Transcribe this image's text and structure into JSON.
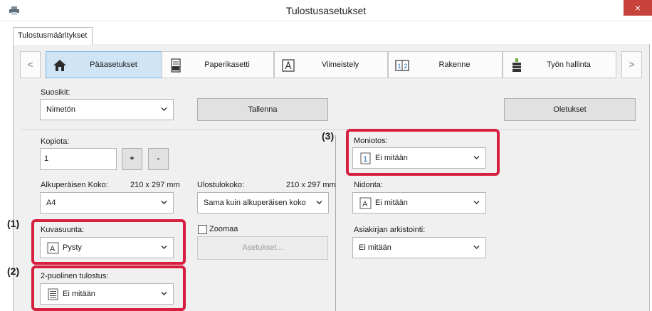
{
  "window": {
    "title": "Tulostusasetukset",
    "close_glyph": "×",
    "app_icon": "printer-icon"
  },
  "top_tab": {
    "label": "Tulostusmääritykset"
  },
  "nav": {
    "prev_glyph": "<",
    "next_glyph": ">",
    "tabs": [
      {
        "label": "Pääasetukset",
        "icon": "home-icon",
        "active": true
      },
      {
        "label": "Paperikasetti",
        "icon": "paper-tray-icon",
        "active": false
      },
      {
        "label": "Viimeistely",
        "icon": "finishing-icon",
        "active": false
      },
      {
        "label": "Rakenne",
        "icon": "layout-icon",
        "active": false
      },
      {
        "label": "Työn hallinta",
        "icon": "job-control-icon",
        "active": false
      }
    ]
  },
  "favorites": {
    "label": "Suosikit:",
    "value": "Nimetön",
    "save_label": "Tallenna",
    "defaults_label": "Oletukset"
  },
  "copies": {
    "label": "Kopiota:",
    "value": "1",
    "plus": "+",
    "minus": "-"
  },
  "original_size": {
    "label": "Alkuperäisen Koko:",
    "dims": "210 x 297 mm",
    "value": "A4"
  },
  "output_size": {
    "label": "Ulostulokoko:",
    "dims": "210 x 297 mm",
    "value": "Sama kuin alkuperäisen koko"
  },
  "orientation": {
    "label": "Kuvasuunta:",
    "value": "Pysty",
    "icon_glyph": "A"
  },
  "zoom": {
    "label": "Zoomaa",
    "checked": false,
    "settings_label": "Asetukset..."
  },
  "duplex": {
    "label": "2-puolinen tulostus:",
    "value": "Ei mitään"
  },
  "n_up": {
    "label": "Moniotos:",
    "value": "Ei mitään",
    "icon_glyph": "1"
  },
  "binding": {
    "label": "Nidonta:",
    "value": "Ei mitään",
    "icon_glyph": "A"
  },
  "archiving": {
    "label": "Asiakirjan arkistointi:",
    "value": "Ei mitään"
  },
  "callouts": {
    "one": "(1)",
    "two": "(2)",
    "three": "(3)"
  },
  "colors": {
    "highlight": "#d71f40",
    "active_tab": "#cfe4f5",
    "close": "#c7423a"
  }
}
